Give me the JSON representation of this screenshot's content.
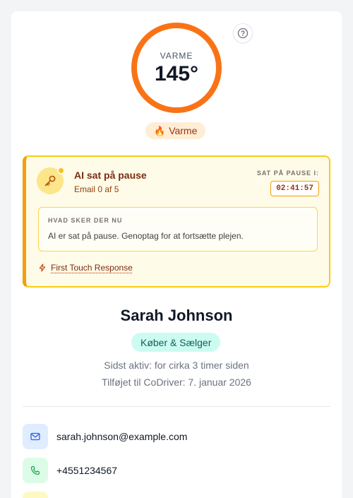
{
  "heat": {
    "label": "VARME",
    "value": "145°",
    "badge_label": "Varme",
    "badge_icon": "flame-icon",
    "ring_color": "#f97316"
  },
  "ai_status": {
    "title": "AI sat på pause",
    "subtitle": "Email 0 af 5",
    "paused_label": "SAT PÅ PAUSE I:",
    "timer": "02:41:57",
    "info_heading": "HVAD SKER DER NU",
    "info_text": "AI er sat på pause. Genoptag for at fortsætte plejen.",
    "sequence_name": "First Touch Response",
    "accent_color": "#f59e0b",
    "background_color": "#fefbe8"
  },
  "contact": {
    "name": "Sarah Johnson",
    "role": "Køber & Sælger",
    "last_active": "Sidst aktiv: for cirka 3 timer siden",
    "added": "Tilføjet til CoDriver: 7. januar 2026",
    "email": "sarah.johnson@example.com",
    "phone": "+4551234567"
  }
}
